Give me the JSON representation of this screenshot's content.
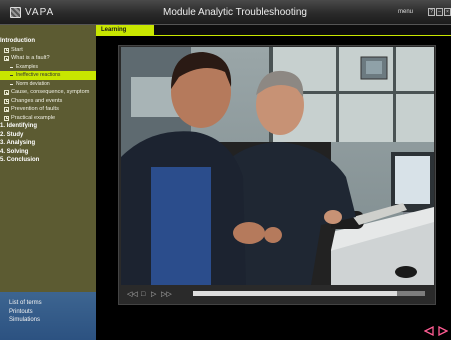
{
  "titlebar": {
    "logo": "VAPA",
    "title": "Module Analytic Troubleshooting",
    "menu": "menu",
    "window_buttons": [
      "?",
      "–",
      "×"
    ]
  },
  "tab": {
    "label": "Learning"
  },
  "sidebar": {
    "items": [
      {
        "label": "Introduction",
        "style": "h"
      },
      {
        "label": "Start",
        "style": "lv1",
        "icon": "plus-box-icon"
      },
      {
        "label": "What is a fault?",
        "style": "lv1",
        "icon": "plus-box-icon"
      },
      {
        "label": "Examples",
        "style": "lv2",
        "icon": "dash-icon"
      },
      {
        "label": "Ineffective reactions",
        "style": "lv2 active",
        "icon": "dash-icon"
      },
      {
        "label": "Norm deviation",
        "style": "lv2",
        "icon": "dash-icon"
      },
      {
        "label": "Cause, consequence, symptom",
        "style": "lv1",
        "icon": "plus-box-icon"
      },
      {
        "label": "Changes and events",
        "style": "lv1",
        "icon": "plus-box-icon"
      },
      {
        "label": "Prevention of faults",
        "style": "lv1",
        "icon": "plus-box-icon"
      },
      {
        "label": "Practical example",
        "style": "lv1",
        "icon": "plus-box-icon"
      },
      {
        "label": "1. Identifying",
        "style": "h"
      },
      {
        "label": "2. Study",
        "style": "h"
      },
      {
        "label": "3. Analysing",
        "style": "h"
      },
      {
        "label": "4. Solving",
        "style": "h"
      },
      {
        "label": "5. Conclusion",
        "style": "h"
      }
    ],
    "bottom_links": [
      "List of terms",
      "Printouts",
      "Simulations"
    ]
  },
  "player": {
    "progress": 0.88,
    "controls": [
      "rewind-icon",
      "stop-icon",
      "play-icon",
      "fast-forward-icon"
    ]
  },
  "colors": {
    "accent": "#c8e600",
    "sidebar": "#5c5b32",
    "sidebar_bottom": "#2c5281",
    "arrow": "#ff5c93"
  }
}
